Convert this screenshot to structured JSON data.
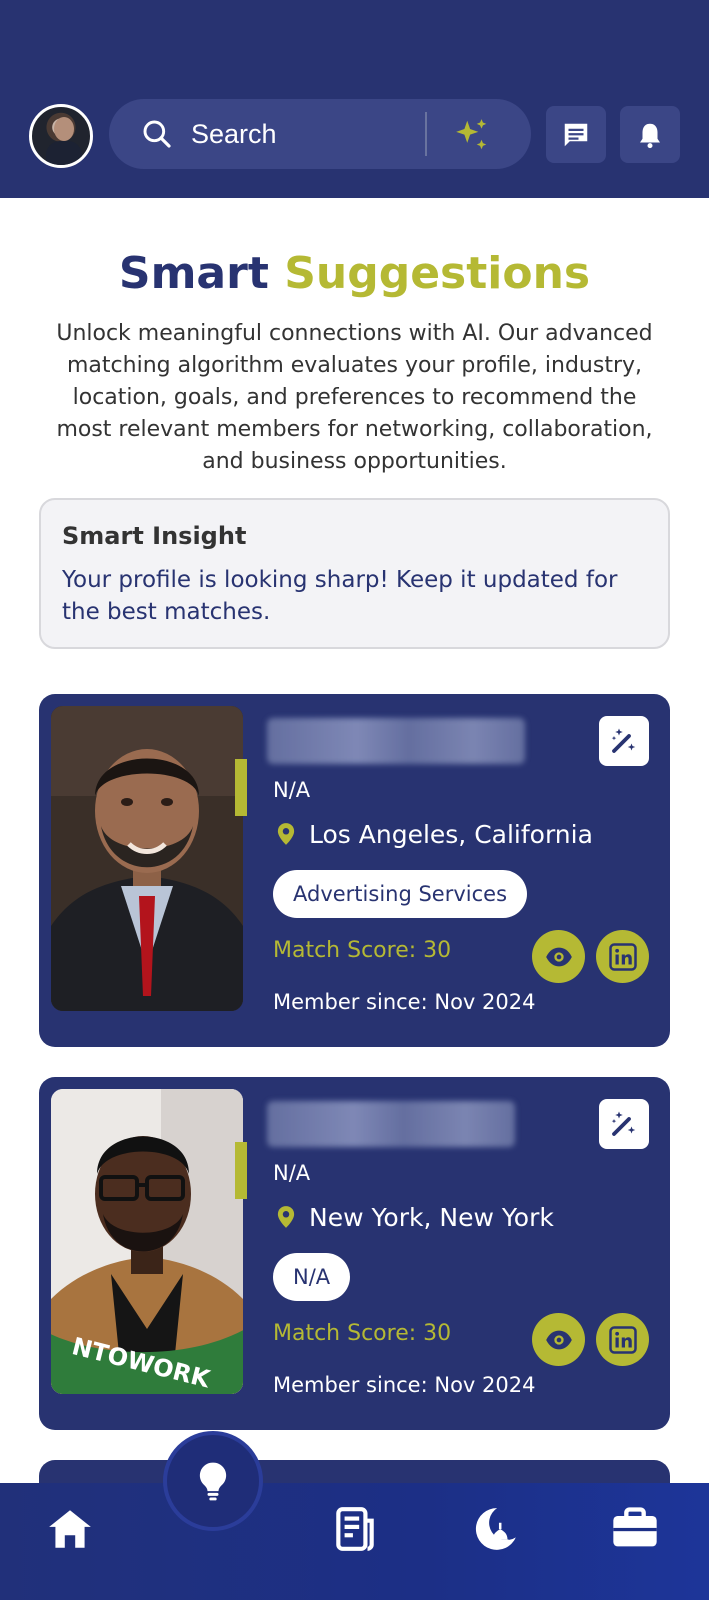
{
  "header": {
    "search_placeholder": "Search",
    "avatar_icon": "user-avatar",
    "ai_icon": "sparkles-icon",
    "chat_icon": "chat-icon",
    "bell_icon": "bell-icon",
    "bg_color": "#283371"
  },
  "intro": {
    "title_part1": "Smart",
    "title_part2": "Suggestions",
    "description": "Unlock meaningful connections with AI. Our advanced matching algorithm evaluates your profile, industry, location, goals, and preferences to recommend the most relevant members for networking, collaboration, and business opportunities."
  },
  "insight": {
    "title": "Smart Insight",
    "text": "Your profile is looking sharp! Keep it updated for the best matches."
  },
  "members": [
    {
      "role": "N/A",
      "location": "Los Angeles, California",
      "tag": "Advertising Services",
      "match_score": "Match Score: 30",
      "member_since": "Member since: Nov 2024"
    },
    {
      "role": "N/A",
      "location": "New York, New York",
      "tag": "N/A",
      "match_score": "Match Score: 30",
      "member_since": "Member since: Nov 2024",
      "photo_banner": "NTOWORK"
    }
  ],
  "nav": {
    "items": [
      "home-icon",
      "lightbulb-icon",
      "news-icon",
      "mosque-icon",
      "briefcase-icon"
    ]
  },
  "colors": {
    "primary": "#283371",
    "accent": "#b5b934"
  }
}
